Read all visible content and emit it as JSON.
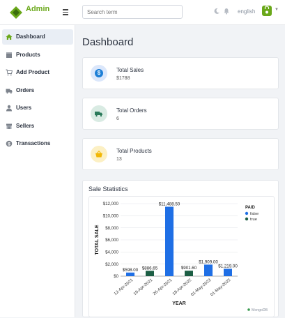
{
  "header": {
    "brand": "Admin",
    "brand_sub": "",
    "search_placeholder": "Search term",
    "language": "english"
  },
  "sidebar": {
    "items": [
      {
        "label": "Dashboard",
        "icon": "home-icon",
        "active": true
      },
      {
        "label": "Products",
        "icon": "box-icon",
        "active": false
      },
      {
        "label": "Add Product",
        "icon": "cart-icon",
        "active": false
      },
      {
        "label": "Orders",
        "icon": "truck-icon",
        "active": false
      },
      {
        "label": "Users",
        "icon": "user-icon",
        "active": false
      },
      {
        "label": "Sellers",
        "icon": "store-icon",
        "active": false
      },
      {
        "label": "Transactions",
        "icon": "dollar-icon",
        "active": false
      }
    ]
  },
  "main": {
    "title": "Dashboard",
    "cards": [
      {
        "label": "Total Sales",
        "value": "$1788",
        "icon": "dollar-icon",
        "color": "#1c7ed6",
        "bg": "#dbe7fb"
      },
      {
        "label": "Total Orders",
        "value": "6",
        "icon": "truck-icon",
        "color": "#2a7a5a",
        "bg": "#d9ebe3"
      },
      {
        "label": "Total Products",
        "value": "13",
        "icon": "basket-icon",
        "color": "#f2b705",
        "bg": "#fcf0c4"
      }
    ],
    "stats_title": "Sale Statistics"
  },
  "chart_data": {
    "type": "bar",
    "categories": [
      "12-Apr-2021",
      "19-Apr-2021",
      "26-Apr-2021",
      "18-Apr-2022",
      "01-May-2023",
      "01-May-2023"
    ],
    "values": [
      598,
      886.65,
      11488.5,
      901.6,
      1909,
      1219
    ],
    "value_labels": [
      "$598.00",
      "$886.65",
      "$11,488.50",
      "$901.60",
      "$1,909.00",
      "$1,219.00"
    ],
    "paid": [
      "false",
      "true",
      "false",
      "true",
      "false",
      "false"
    ],
    "legend_title": "PAID",
    "legend": [
      {
        "name": "false",
        "color": "#1f6fe5"
      },
      {
        "name": "true",
        "color": "#1c5e44"
      }
    ],
    "xlabel": "YEAR",
    "ylabel": "TOTAL SALE",
    "ylim": [
      0,
      12000
    ],
    "yticks": [
      "$0",
      "$2,000",
      "$4,000",
      "$6,000",
      "$8,000",
      "$10,000",
      "$12,000"
    ],
    "watermark": "MongoDB",
    "grid": true,
    "legend_position": "top-right"
  }
}
